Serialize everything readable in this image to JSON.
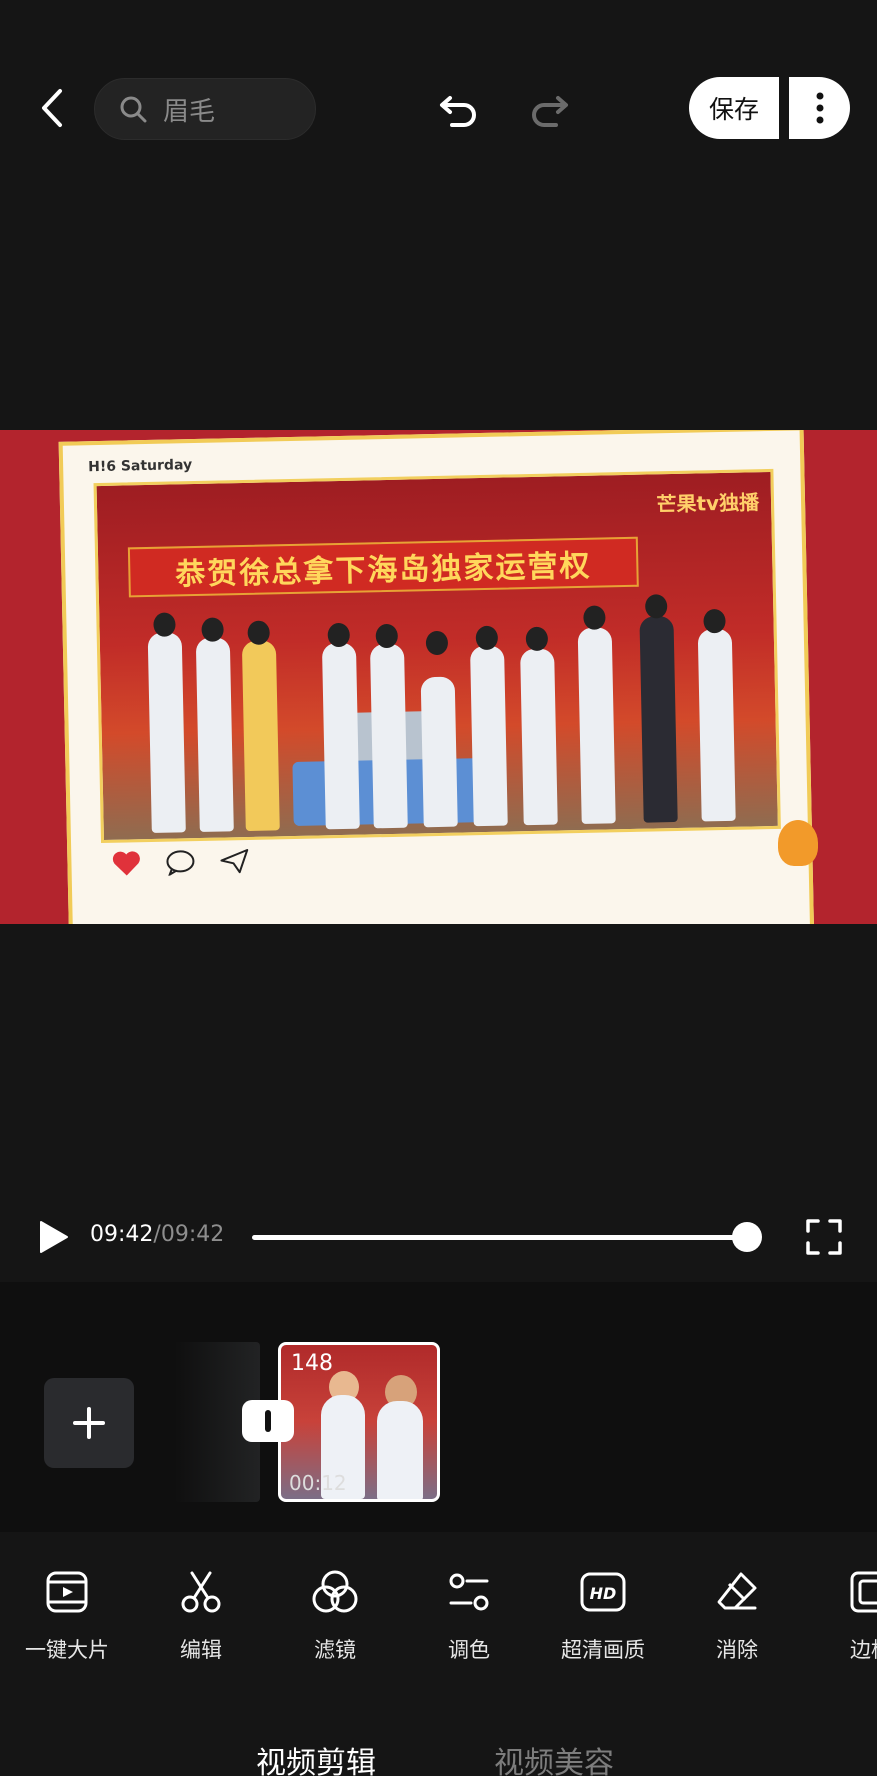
{
  "header": {
    "search_text": "眉毛",
    "save_label": "保存"
  },
  "preview": {
    "card_header": "H!6  Saturday",
    "banner_text": "恭贺徐总拿下海岛独家运营权",
    "channel_logo": "芒果tv独播"
  },
  "player": {
    "current_time": "09:42",
    "total_time": "/09:42",
    "progress": 1.0
  },
  "timeline": {
    "clip_count": "148",
    "clip_duration": "00:12"
  },
  "tools": [
    {
      "label": "一键大片",
      "icon": "film-icon"
    },
    {
      "label": "编辑",
      "icon": "scissors-icon"
    },
    {
      "label": "滤镜",
      "icon": "filter-icon"
    },
    {
      "label": "调色",
      "icon": "adjust-icon"
    },
    {
      "label": "超清画质",
      "icon": "hd-icon"
    },
    {
      "label": "消除",
      "icon": "eraser-icon"
    },
    {
      "label": "边框",
      "icon": "border-icon"
    }
  ],
  "tabs": {
    "active": "视频剪辑",
    "inactive": "视频美容"
  },
  "colors": {
    "background": "#151515",
    "accent": "#ffffff",
    "banner_red": "#d02a22"
  }
}
